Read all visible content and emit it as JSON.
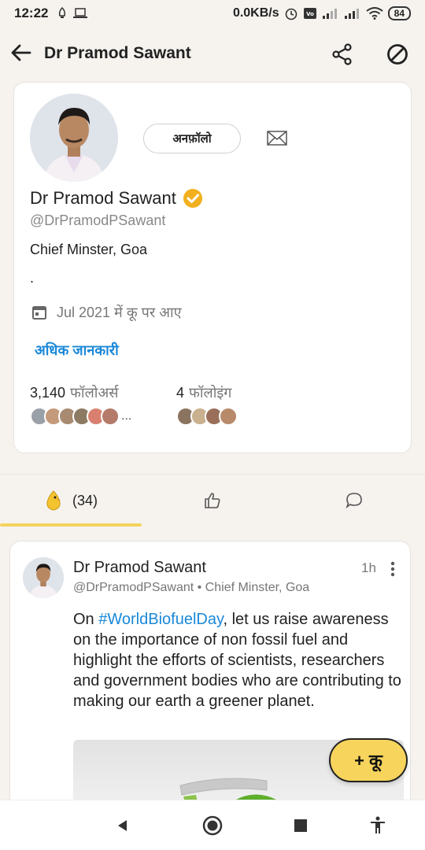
{
  "status_bar": {
    "time": "12:22",
    "net_speed": "0.0KB/s",
    "battery": "84"
  },
  "app_bar": {
    "title": "Dr Pramod Sawant"
  },
  "profile": {
    "unfollow_label": "अनफ़ॉलो",
    "name": "Dr Pramod Sawant",
    "handle": "@DrPramodPSawant",
    "bio": "Chief Minster, Goa",
    "bio_extra": ".",
    "joined": "Jul 2021 में कू पर आए",
    "more_info": "अधिक जानकारी",
    "followers_count": "3,140",
    "followers_label": "फॉलोअर्स",
    "following_count": "4",
    "following_label": "फॉलोइंग",
    "followers_more": "..."
  },
  "tabs": {
    "koos_count": "(34)"
  },
  "post": {
    "author": "Dr Pramod Sawant",
    "time": "1h",
    "meta": "@DrPramodPSawant • Chief Minster, Goa",
    "text_prefix": "On ",
    "hashtag": "#WorldBiofuelDay",
    "text_rest": ", let us raise awareness on the importance of non fossil fuel and highlight the efforts of scientists, researchers and government bodies who are contributing to making our earth a greener planet."
  },
  "fab": {
    "label": "+ कू"
  },
  "colors": {
    "accent_yellow": "#f7d45c",
    "link_blue": "#1a88d8",
    "verified_gold": "#f2b01e"
  }
}
